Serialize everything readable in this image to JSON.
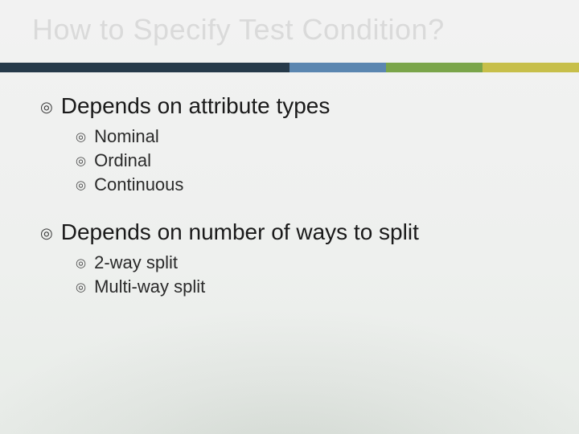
{
  "title": "How to Specify Test Condition?",
  "sections": [
    {
      "heading": "Depends on attribute types",
      "items": [
        "Nominal",
        "Ordinal",
        "Continuous"
      ]
    },
    {
      "heading": "Depends on number of ways to split",
      "items": [
        "2-way split",
        "Multi-way split"
      ]
    }
  ],
  "bullet_glyph": "◎"
}
